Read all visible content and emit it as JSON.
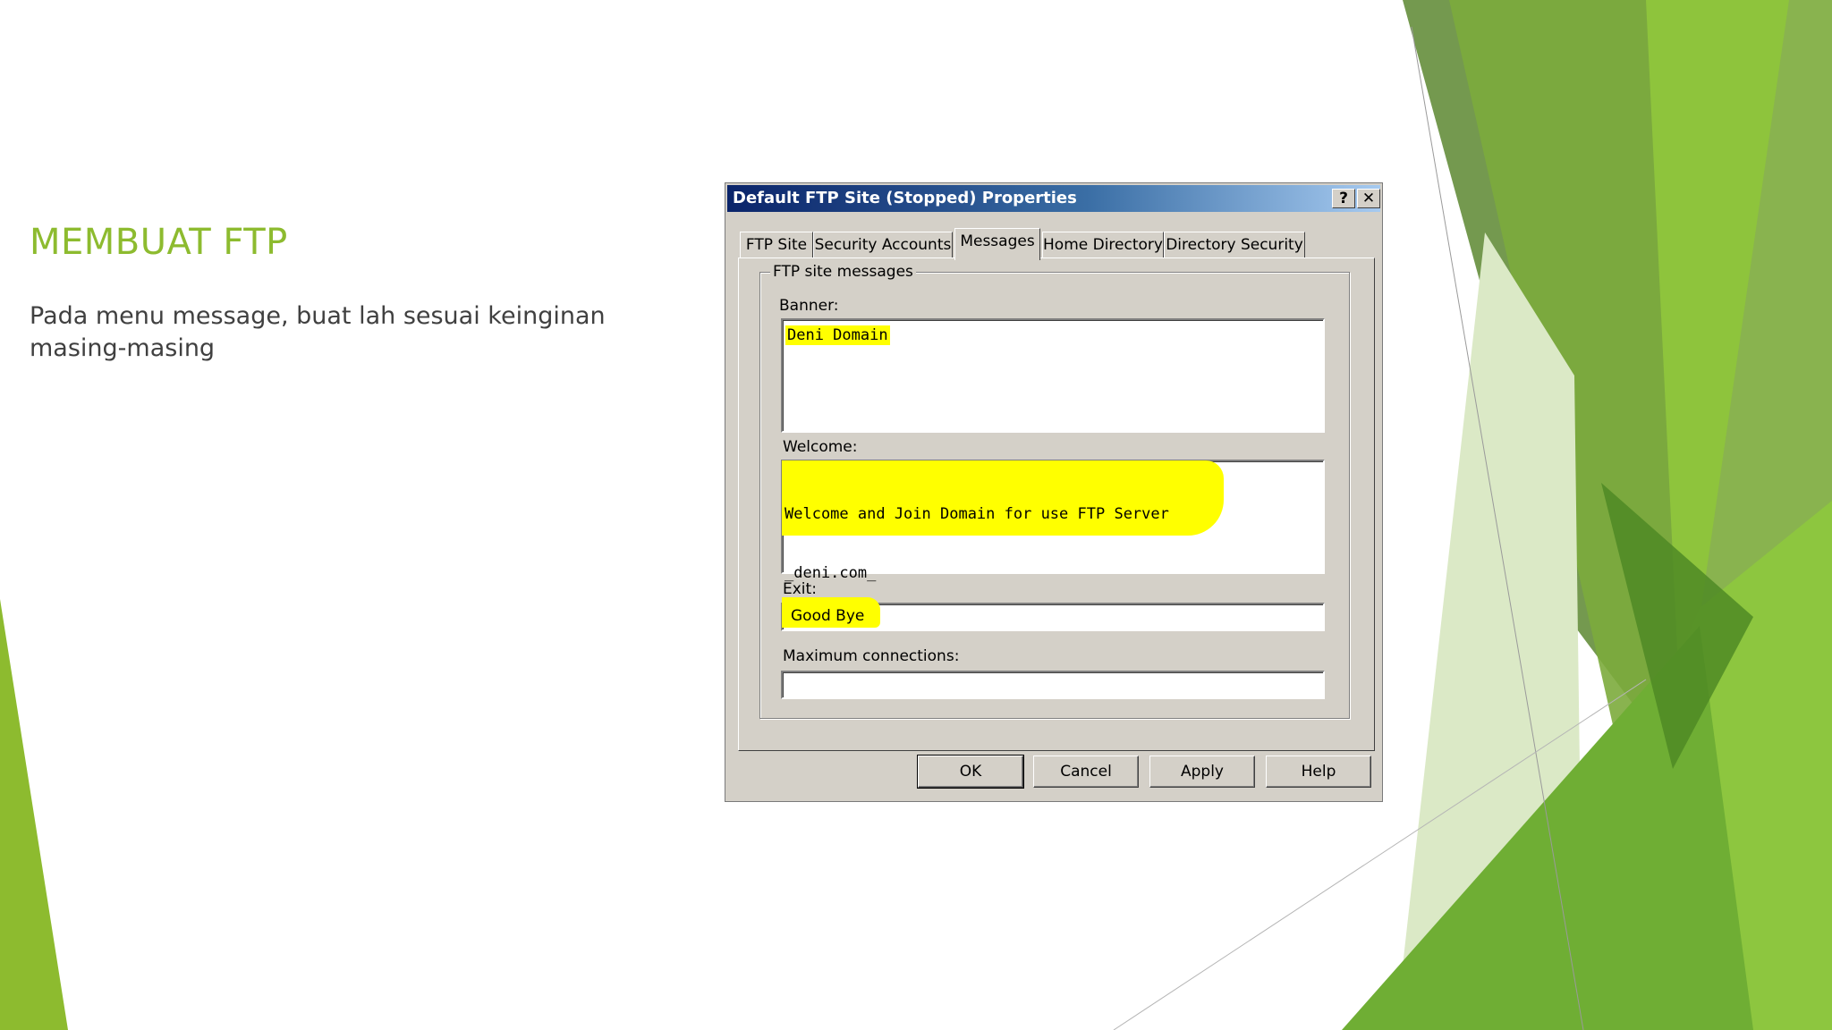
{
  "slide": {
    "title": "MEMBUAT FTP",
    "body": "Pada menu message, buat lah sesuai keinginan masing-masing"
  },
  "dialog": {
    "title": "Default FTP Site (Stopped) Properties",
    "help_glyph": "?",
    "close_glyph": "✕",
    "tabs": [
      "FTP Site",
      "Security Accounts",
      "Messages",
      "Home Directory",
      "Directory Security"
    ],
    "active_tab": "Messages",
    "group_label": "FTP site messages",
    "banner_label": "Banner:",
    "banner_value": "Deni Domain",
    "welcome_label": "Welcome:",
    "welcome_line1": "Welcome and Join Domain for use FTP Server",
    "welcome_line2": "_deni.com_",
    "exit_label": "Exit:",
    "exit_value": "Good Bye",
    "max_conn_label": "Maximum connections:",
    "max_conn_value": "",
    "buttons": {
      "ok": "OK",
      "cancel": "Cancel",
      "apply": "Apply",
      "help": "Help"
    }
  },
  "colors": {
    "title_green": "#8dbb2f",
    "highlight": "#ffff00",
    "dialog_face": "#d4d0c8",
    "titlebar_dark": "#0a246a"
  }
}
